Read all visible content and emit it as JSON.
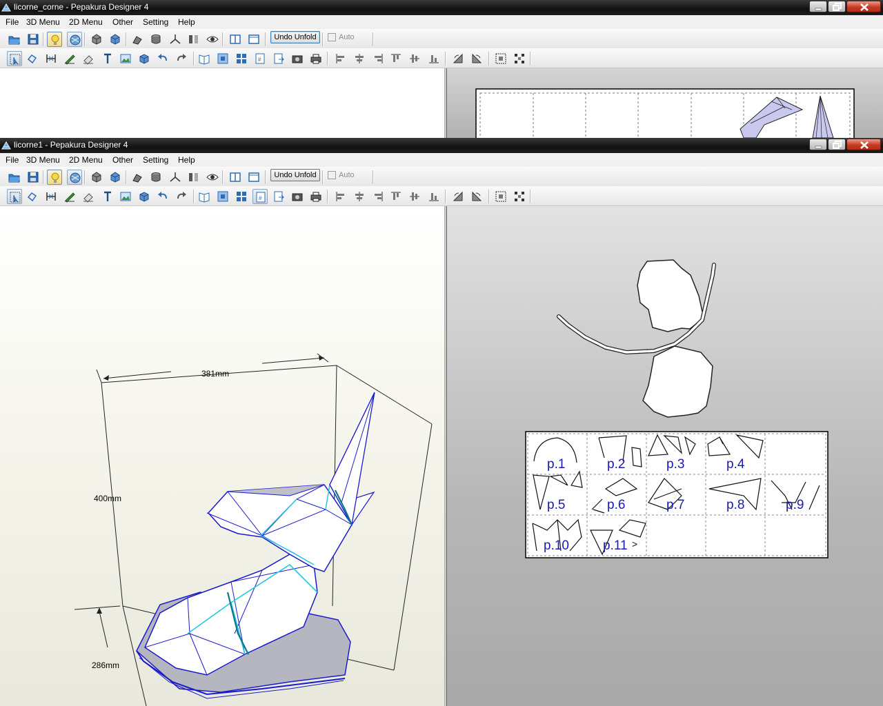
{
  "windows": [
    {
      "title": "licorne_corne - Pepakura Designer 4",
      "menu": [
        "File",
        "3D Menu",
        "2D Menu",
        "Other",
        "Setting",
        "Help"
      ],
      "undo_unfold_label": "Undo Unfold",
      "auto_label": "Auto"
    },
    {
      "title": "licorne1 - Pepakura Designer 4",
      "menu": [
        "File",
        "3D Menu",
        "2D Menu",
        "Other",
        "Setting",
        "Help"
      ],
      "undo_unfold_label": "Undo Unfold",
      "auto_label": "Auto"
    }
  ],
  "dimensions": {
    "width": "381mm",
    "height": "400mm",
    "depth": "286mm"
  },
  "pages": [
    "p.1",
    "p.2",
    "p.3",
    "p.4",
    "p.5",
    "p.6",
    "p.7",
    "p.8",
    "p.9",
    "p.10",
    "p.11"
  ],
  "page_more_marker": ">",
  "colors": {
    "edge_blue": "#1a1acc",
    "fold_cyan": "#22c8e0",
    "page_label": "#1a1ab0",
    "close_button": "#c73b25"
  },
  "icons": {
    "toolbar1": [
      "open-folder-icon",
      "save-icon",
      "light-bulb-icon",
      "texture-icon",
      "move-3d-icon",
      "rotate-3d-icon",
      "shape-icon",
      "cylinder-icon",
      "axis-icon",
      "split-view-icon",
      "eye-icon",
      "layout-panel-icon",
      "window-icon"
    ],
    "toolbar2": [
      "select-tool-icon",
      "lasso-icon",
      "join-edge-icon",
      "pen-line-icon",
      "eraser-icon",
      "text-tool-icon",
      "image-tool-icon",
      "cube-icon",
      "undo-icon",
      "redo-icon",
      "book-icon",
      "zoom-fit-icon",
      "grid-icon",
      "page-number-icon",
      "export-icon",
      "camera-icon",
      "print-icon",
      "align-left-icon",
      "align-center-icon",
      "align-right-icon",
      "align-top-icon",
      "align-middle-icon",
      "align-bottom-icon",
      "flip-left-icon",
      "flip-right-icon",
      "fit-selection-icon",
      "distribute-icon"
    ]
  }
}
